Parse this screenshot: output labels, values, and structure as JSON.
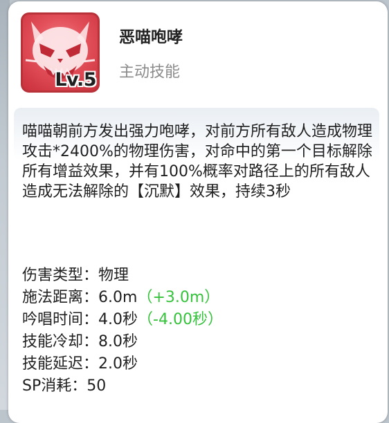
{
  "skill": {
    "name": "恶喵咆哮",
    "type": "主动技能",
    "level_label": "Lv.5",
    "icon": "angry-cat-skull-icon",
    "icon_bg_color": "#e3505a"
  },
  "description": "喵喵朝前方发出强力咆哮，对前方所有敌人造成物理攻击*2400%的物理伤害，对命中的第一个目标解除所有增益效果，并有100%概率对路径上的所有敌人造成无法解除的【沉默】效果，持续3秒",
  "stats": [
    {
      "label": "伤害类型：",
      "value": "物理",
      "bonus": ""
    },
    {
      "label": "施法距离：",
      "value": "6.0m",
      "bonus": "（+3.0m）"
    },
    {
      "label": "吟唱时间：",
      "value": "4.0秒",
      "bonus": "（-4.00秒）"
    },
    {
      "label": "技能冷却：",
      "value": "8.0秒",
      "bonus": ""
    },
    {
      "label": "技能延迟：",
      "value": "2.0秒",
      "bonus": ""
    },
    {
      "label": "SP消耗：",
      "value": "50",
      "bonus": ""
    }
  ],
  "colors": {
    "bonus": "#35c23b",
    "text": "#1f1f1f",
    "subtext": "#8a8a8a"
  }
}
